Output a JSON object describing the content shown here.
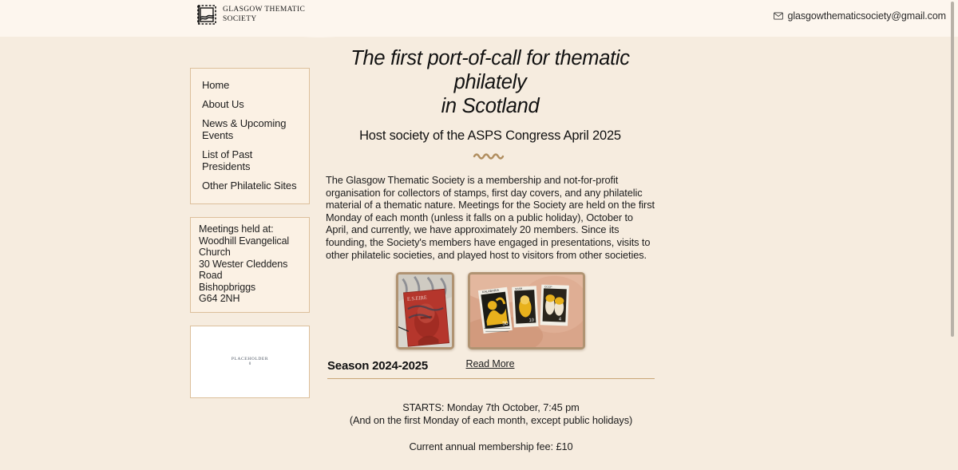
{
  "header": {
    "logo_line1": "GLASGOW THEMATIC",
    "logo_line2": "SOCIETY",
    "logo_text": "GLASGOW THEMATIC\nSOCIETY",
    "logo_icon": "postage-stamp-icon",
    "email_icon": "envelope-icon",
    "email": "glasgowthematicsociety@gmail.com"
  },
  "sidebar": {
    "nav": [
      {
        "label": "Home"
      },
      {
        "label": "About Us"
      },
      {
        "label": "News & Upcoming Events"
      },
      {
        "label": "List of Past Presidents"
      },
      {
        "label": "Other Philatelic Sites"
      }
    ],
    "address": [
      "Meetings held at:",
      "Woodhill Evangelical Church",
      "30 Wester Cleddens Road",
      "Bishopbriggs",
      "G64 2NH"
    ],
    "placeholder": {
      "label": "PLACEHOLDER",
      "sub": "0"
    }
  },
  "main": {
    "title": "The first port-of-call for thematic philately in Scotland",
    "title_line1": "The first port-of-call for thematic philately",
    "title_line2": "in Scotland",
    "subtitle": "Host society of the ASPS Congress April 2025",
    "divider_icon": "wave-ornament-icon",
    "paragraph": "The Glasgow Thematic Society is a membership and not-for-profit organisation for collectors of stamps, first day covers, and any philatelic material of a thematic nature. Meetings for the Society are held on the first Monday of each month (unless it falls on a public holiday), October to April, and currently, we have approximately 20 members. Since its founding, the Society's members have engaged in presentations, visits to other philatelic societies, and played host to visitors from other societies.",
    "photos": [
      {
        "name": "stamp-portrait-photo",
        "alt": "Red portrait postage stamp on envelope"
      },
      {
        "name": "stamps-in-hand-photo",
        "alt": "Three yellow and black stamps held in a hand"
      }
    ],
    "read_more": "Read More"
  },
  "season": {
    "title": "Season 2024-2025",
    "start_line": "STARTS: Monday 7th October, 7:45 pm",
    "note_line": "(And on the first Monday of each month, except public holidays)",
    "fee_line": "Current annual membership fee: £10"
  },
  "colors": {
    "page_background": "#f6ecdf",
    "top_band": "#fdf6ee",
    "panel_border": "#dcbf9b",
    "panel_fill": "#fbf1e4",
    "rule": "#c9a677",
    "ornament": "#b08d5e",
    "text": "#1d1d1d"
  }
}
